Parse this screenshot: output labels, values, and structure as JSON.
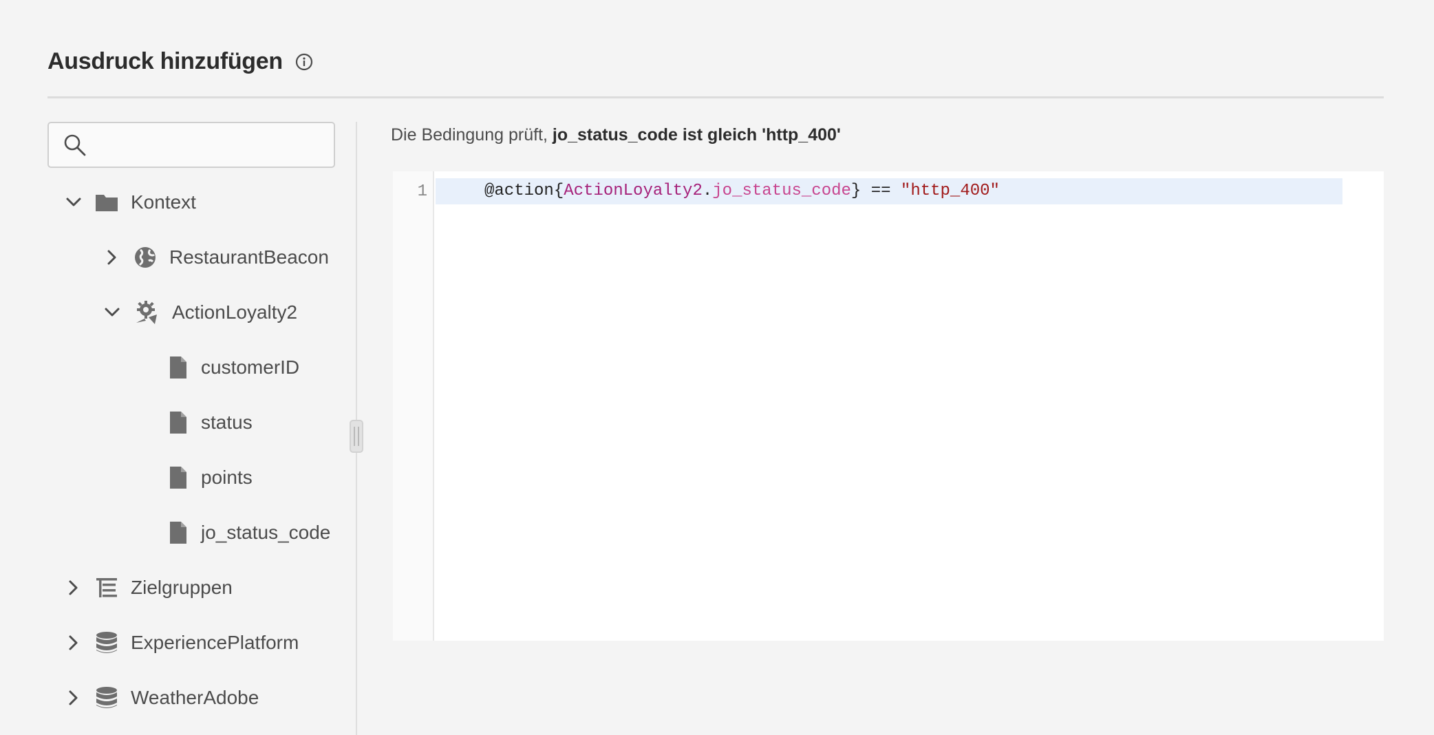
{
  "header": {
    "title": "Ausdruck hinzufügen",
    "info_icon": "info-icon"
  },
  "search": {
    "placeholder": "",
    "value": "",
    "icon": "search-icon"
  },
  "tree": {
    "kontext": {
      "label": "Kontext",
      "icon": "folder-icon",
      "expanded": true
    },
    "restaurant_beacon": {
      "label": "RestaurantBeacon",
      "icon": "globe-icon",
      "expanded": false
    },
    "action_loyalty": {
      "label": "ActionLoyalty2",
      "icon": "action-gear-icon",
      "expanded": true
    },
    "fields": [
      {
        "label": "customerID",
        "icon": "file-icon"
      },
      {
        "label": "status",
        "icon": "file-icon"
      },
      {
        "label": "points",
        "icon": "file-icon"
      },
      {
        "label": "jo_status_code",
        "icon": "file-icon"
      }
    ],
    "zielgruppen": {
      "label": "Zielgruppen",
      "icon": "segments-icon",
      "expanded": false
    },
    "experience_platform": {
      "label": "ExperiencePlatform",
      "icon": "database-icon",
      "expanded": false
    },
    "weather_adobe": {
      "label": "WeatherAdobe",
      "icon": "database-icon",
      "expanded": false
    }
  },
  "condition": {
    "prefix": "Die Bedingung prüft, ",
    "expression": "jo_status_code ist gleich 'http_400'"
  },
  "editor": {
    "line_number": "1",
    "tokens": {
      "prefix": "@action{",
      "entity": "ActionLoyalty2",
      "dot": ".",
      "field": "jo_status_code",
      "close": "} == ",
      "string": "\"http_400\""
    }
  },
  "colors": {
    "background": "#f4f4f4",
    "entity_token": "#a6227a",
    "field_token": "#c8458f",
    "string_token": "#a11a1a",
    "active_line": "#e8f0fb"
  }
}
